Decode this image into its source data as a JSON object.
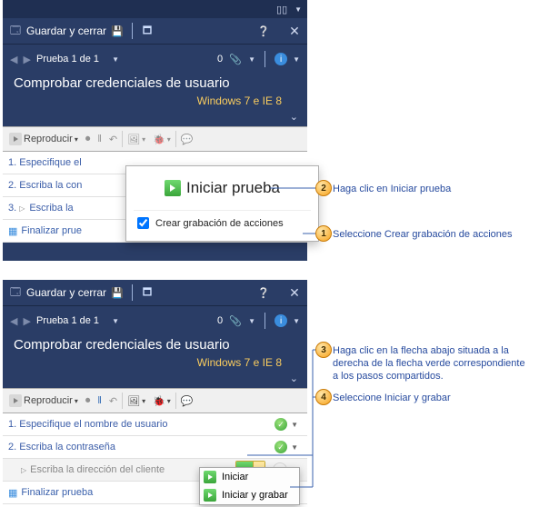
{
  "top_panel": {
    "save_close": "Guardar y cerrar",
    "nav_label": "Prueba 1 de 1",
    "counter": "0",
    "title": "Comprobar credenciales de usuario",
    "subtitle": "Windows 7 e IE 8",
    "reproduce": "Reproducir",
    "steps": {
      "s1": "1. Especifique el",
      "s2": "2. Escriba la con",
      "s3": "3.    Escriba la",
      "s4": "Finalizar prue"
    },
    "popup": {
      "start": "Iniciar prueba",
      "create_rec": "Crear grabación de acciones"
    }
  },
  "bottom_panel": {
    "save_close": "Guardar y cerrar",
    "nav_label": "Prueba 1 de 1",
    "counter": "0",
    "title": "Comprobar credenciales de usuario",
    "subtitle": "Windows 7 e IE 8",
    "reproduce": "Reproducir",
    "steps": {
      "s1": "1. Especifique el nombre de usuario",
      "s2": "2. Escriba la contraseña",
      "s3": "Escriba la dirección del cliente",
      "s4": "Finalizar prueba"
    },
    "menu": {
      "m1": "Iniciar",
      "m2": "Iniciar y grabar"
    }
  },
  "callouts": {
    "c1": "Seleccione Crear grabación de acciones",
    "c2": "Haga clic en Iniciar prueba",
    "c3": "Haga clic en la flecha abajo situada a la derecha de la flecha verde correspondiente a los pasos compartidos.",
    "c4": "Seleccione Iniciar y grabar"
  }
}
